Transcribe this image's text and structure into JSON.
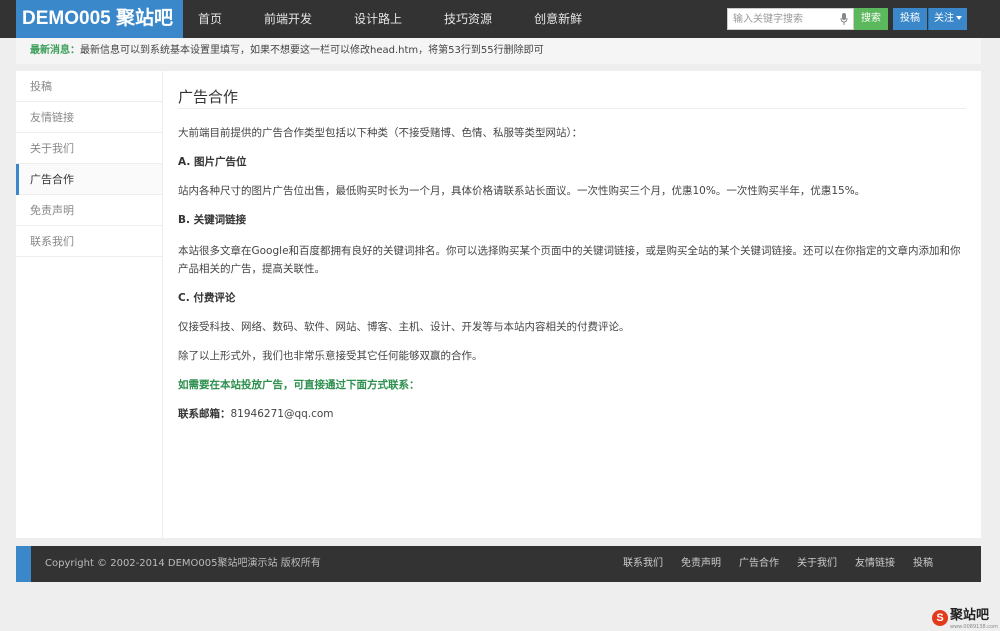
{
  "header": {
    "logo": "DEMO005 聚站吧",
    "nav": [
      "首页",
      "前端开发",
      "设计路上",
      "技巧资源",
      "创意新鲜"
    ],
    "search": {
      "placeholder": "输入关键字搜索",
      "button": "搜索"
    },
    "post_button": "投稿",
    "follow_button": "关注"
  },
  "notice": {
    "label": "最新消息：",
    "text": "最新信息可以到系统基本设置里填写，如果不想要这一栏可以修改head.htm，将第53行到55行删除即可"
  },
  "sidebar": {
    "items": [
      {
        "label": "投稿"
      },
      {
        "label": "友情链接"
      },
      {
        "label": "关于我们"
      },
      {
        "label": "广告合作",
        "active": true
      },
      {
        "label": "免责声明"
      },
      {
        "label": "联系我们"
      }
    ]
  },
  "content": {
    "title": "广告合作",
    "intro": "大前端目前提供的广告合作类型包括以下种类（不接受赌博、色情、私服等类型网站）：",
    "section_a": {
      "heading": "A. 图片广告位",
      "text": "站内各种尺寸的图片广告位出售，最低购买时长为一个月，具体价格请联系站长面议。一次性购买三个月，优惠10%。一次性购买半年，优惠15%。"
    },
    "section_b": {
      "heading": "B. 关键词链接",
      "text": "本站很多文章在Google和百度都拥有良好的关键词排名。你可以选择购买某个页面中的关键词链接，或是购买全站的某个关键词链接。还可以在你指定的文章内添加和你产品相关的广告，提高关联性。"
    },
    "section_c": {
      "heading": "C. 付费评论",
      "text": "仅接受科技、网络、数码、软件、网站、博客、主机、设计、开发等与本站内容相关的付费评论。"
    },
    "outro": "除了以上形式外，我们也非常乐意接受其它任何能够双赢的合作。",
    "contact_prompt": "如需要在本站投放广告，可直接通过下面方式联系：",
    "contact_label": "联系邮箱：",
    "contact_email": "81946271@qq.com"
  },
  "footer": {
    "copyright": "Copyright © 2002-2014 DEMO005聚站吧演示站 版权所有",
    "links": [
      "联系我们",
      "免责声明",
      "广告合作",
      "关于我们",
      "友情链接",
      "投稿"
    ]
  },
  "watermark": {
    "badge": "S",
    "text": "聚站吧",
    "sub": "www.0089138.com"
  },
  "colors": {
    "header_bg": "#333333",
    "brand_blue": "#3a87c9",
    "search_green": "#5cb85c",
    "highlight_green": "#2d8f4e"
  }
}
